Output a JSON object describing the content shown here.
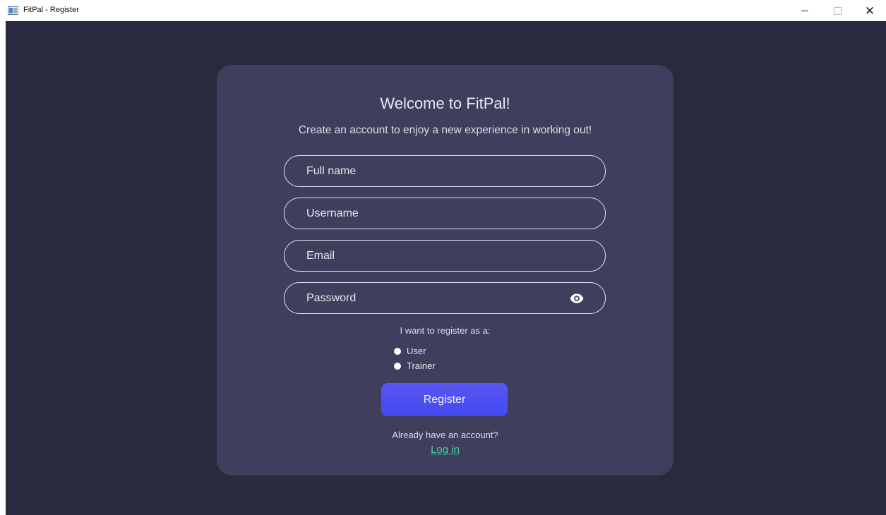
{
  "window": {
    "title": "FitPal - Register",
    "controls": {
      "minimize": "minimize",
      "maximize": "maximize",
      "close": "close"
    }
  },
  "card": {
    "title": "Welcome to FitPal!",
    "subtitle": "Create an account to enjoy a new experience in working out!"
  },
  "form": {
    "fields": [
      {
        "name": "full-name-field",
        "placeholder": "Full name",
        "value": ""
      },
      {
        "name": "username-field",
        "placeholder": "Username",
        "value": ""
      },
      {
        "name": "email-field",
        "placeholder": "Email",
        "value": ""
      },
      {
        "name": "password-field",
        "placeholder": "Password",
        "value": "",
        "icon": "eye-icon"
      }
    ],
    "role_label": "I want to register as a:",
    "roles": [
      {
        "label": "User"
      },
      {
        "label": "Trainer"
      }
    ],
    "submit_label": "Register"
  },
  "footer": {
    "prompt": "Already have an account?",
    "link_label": "Log in"
  },
  "colors": {
    "background": "#292a3e",
    "card": "#3f3e5c",
    "accent": "#4a4cf0",
    "link": "#38d6a8"
  }
}
